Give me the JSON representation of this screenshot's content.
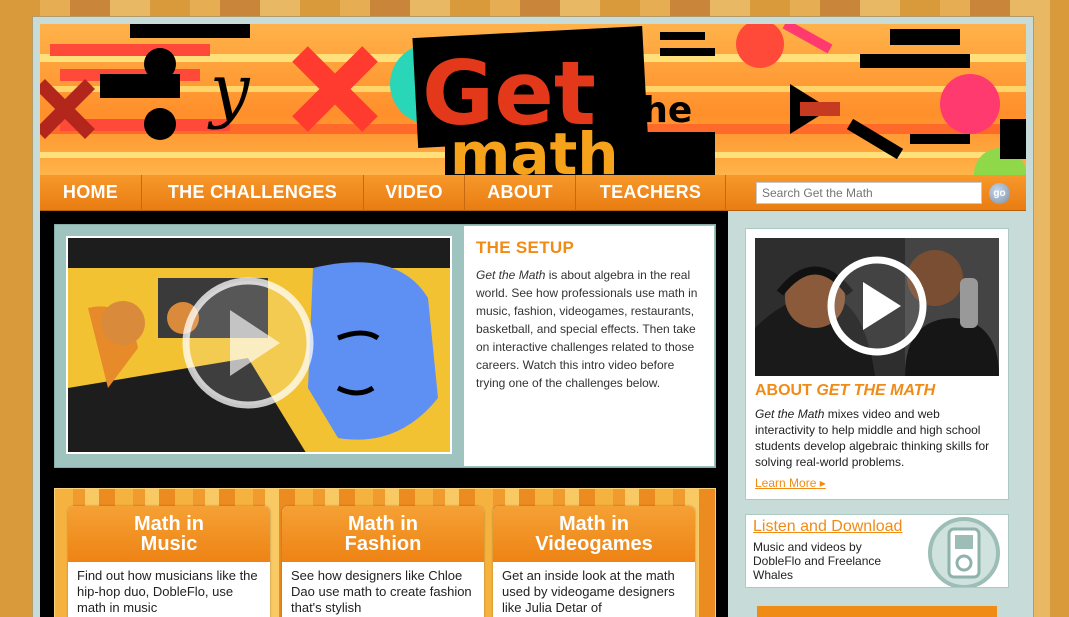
{
  "nav": {
    "items": [
      "HOME",
      "THE CHALLENGES",
      "VIDEO",
      "ABOUT",
      "TEACHERS"
    ]
  },
  "search": {
    "placeholder": "Search Get the Math",
    "button_label": "go"
  },
  "logo": {
    "line1": "Get",
    "line2": "the",
    "line3": "math"
  },
  "setup": {
    "title": "THE SETUP",
    "body_em": "Get the Math",
    "body_rest": " is about algebra in the real world. See how professionals use math in music, fashion, videogames, restaurants, basketball, and special effects. Then take on interactive challenges related to those careers. Watch this intro video before trying one of the challenges below."
  },
  "about": {
    "title_prefix": "ABOUT ",
    "title_em": "GET THE MATH",
    "body_em": "Get the Math",
    "body_rest": " mixes video and web interactivity to help middle and high school students develop algebraic thinking skills for solving real-world problems.",
    "learn_more": "Learn More"
  },
  "listen": {
    "title": "Listen and Download",
    "body": "Music and videos by DobleFlo and Freelance Whales"
  },
  "challenges": [
    {
      "title_line1": "Math in",
      "title_line2": "Music",
      "body": "Find out how musicians like the hip-hop duo, DobleFlo, use math in music"
    },
    {
      "title_line1": "Math in",
      "title_line2": "Fashion",
      "body": "See how designers like Chloe Dao use math to create fashion that's stylish"
    },
    {
      "title_line1": "Math in",
      "title_line2": "Videogames",
      "body": "Get an inside look at the math used by videogame designers like Julia Detar of"
    }
  ],
  "colors": {
    "accent": "#f08b16",
    "nav": "#ee8314",
    "panel": "#9fc4bf"
  }
}
